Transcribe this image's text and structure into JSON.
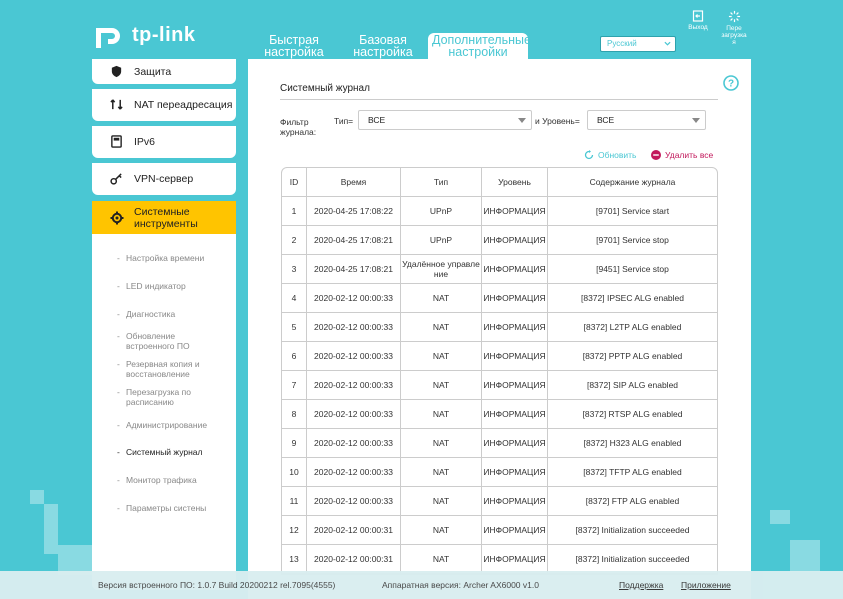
{
  "header": {
    "logo_text": "tp-link",
    "tabs": [
      {
        "line1": "Быстрая",
        "line2": "настройка"
      },
      {
        "line1": "Базовая",
        "line2": "настройка"
      },
      {
        "line1": "Дополнительные",
        "line2": "настройки"
      }
    ],
    "language": "Русский",
    "logout_label": "Выход",
    "reboot_label_1": "Пере",
    "reboot_label_2": "загрузка",
    "reboot_label_3": "я"
  },
  "sidebar": {
    "items": [
      {
        "label": "Защита",
        "icon": "shield-icon"
      },
      {
        "label": "NAT переадресация",
        "icon": "nat-icon"
      },
      {
        "label": "IPv6",
        "icon": "ipv6-icon"
      },
      {
        "label": "VPN-сервер",
        "icon": "vpn-key-icon"
      },
      {
        "label_1": "Системные",
        "label_2": "инструменты",
        "icon": "gear-icon"
      }
    ],
    "submenu": [
      {
        "label": "Настройка времени"
      },
      {
        "label": "LED индикатор"
      },
      {
        "label": "Диагностика"
      },
      {
        "label_1": "Обновление",
        "label_2": "встроенного ПО"
      },
      {
        "label_1": "Резервная копия и",
        "label_2": "восстановление"
      },
      {
        "label_1": "Перезагрузка по",
        "label_2": "расписанию"
      },
      {
        "label": "Администрирование"
      },
      {
        "label": "Системный журнал"
      },
      {
        "label": "Монитор трафика"
      },
      {
        "label": "Параметры систены"
      }
    ]
  },
  "main": {
    "title": "Системный журнал",
    "filter_label_1": "Фильтр",
    "filter_label_2": "журнала:",
    "type_label": "Тип=",
    "type_value": "ВСЕ",
    "level_label": "и Уровень=",
    "level_value": "ВСЕ",
    "refresh_label": "Обновить",
    "delete_all_label": "Удалить все",
    "columns": [
      "ID",
      "Время",
      "Тип",
      "Уровень",
      "Содержание журнала"
    ],
    "rows": [
      {
        "id": "1",
        "time": "2020-04-25 17:08:22",
        "type": "UPnP",
        "level": "ИНФОРМАЦИЯ",
        "msg": "[9701] Service start"
      },
      {
        "id": "2",
        "time": "2020-04-25 17:08:21",
        "type": "UPnP",
        "level": "ИНФОРМАЦИЯ",
        "msg": "[9701] Service stop"
      },
      {
        "id": "3",
        "time": "2020-04-25 17:08:21",
        "type": "Удалённое управле ние",
        "level": "ИНФОРМАЦИЯ",
        "msg": "[9451] Service stop"
      },
      {
        "id": "4",
        "time": "2020-02-12 00:00:33",
        "type": "NAT",
        "level": "ИНФОРМАЦИЯ",
        "msg": "[8372] IPSEC ALG enabled"
      },
      {
        "id": "5",
        "time": "2020-02-12 00:00:33",
        "type": "NAT",
        "level": "ИНФОРМАЦИЯ",
        "msg": "[8372] L2TP ALG enabled"
      },
      {
        "id": "6",
        "time": "2020-02-12 00:00:33",
        "type": "NAT",
        "level": "ИНФОРМАЦИЯ",
        "msg": "[8372] PPTP ALG enabled"
      },
      {
        "id": "7",
        "time": "2020-02-12 00:00:33",
        "type": "NAT",
        "level": "ИНФОРМАЦИЯ",
        "msg": "[8372] SIP ALG enabled"
      },
      {
        "id": "8",
        "time": "2020-02-12 00:00:33",
        "type": "NAT",
        "level": "ИНФОРМАЦИЯ",
        "msg": "[8372] RTSP ALG enabled"
      },
      {
        "id": "9",
        "time": "2020-02-12 00:00:33",
        "type": "NAT",
        "level": "ИНФОРМАЦИЯ",
        "msg": "[8372] H323 ALG enabled"
      },
      {
        "id": "10",
        "time": "2020-02-12 00:00:33",
        "type": "NAT",
        "level": "ИНФОРМАЦИЯ",
        "msg": "[8372] TFTP ALG enabled"
      },
      {
        "id": "11",
        "time": "2020-02-12 00:00:33",
        "type": "NAT",
        "level": "ИНФОРМАЦИЯ",
        "msg": "[8372] FTP ALG enabled"
      },
      {
        "id": "12",
        "time": "2020-02-12 00:00:31",
        "type": "NAT",
        "level": "ИНФОРМАЦИЯ",
        "msg": "[8372] Initialization succeeded"
      },
      {
        "id": "13",
        "time": "2020-02-12 00:00:31",
        "type": "NAT",
        "level": "ИНФОРМАЦИЯ",
        "msg": "[8372] Initialization succeeded"
      }
    ]
  },
  "footer": {
    "firmware": "Версия встроенного ПО: 1.0.7 Build 20200212 rel.7095(4555)",
    "hardware": "Аппаратная версия: Archer AX6000 v1.0",
    "support": "Поддержка",
    "app": "Приложение"
  },
  "colors": {
    "accent": "#4ac7d3",
    "active": "#ffc400",
    "delete": "#c2185b"
  }
}
